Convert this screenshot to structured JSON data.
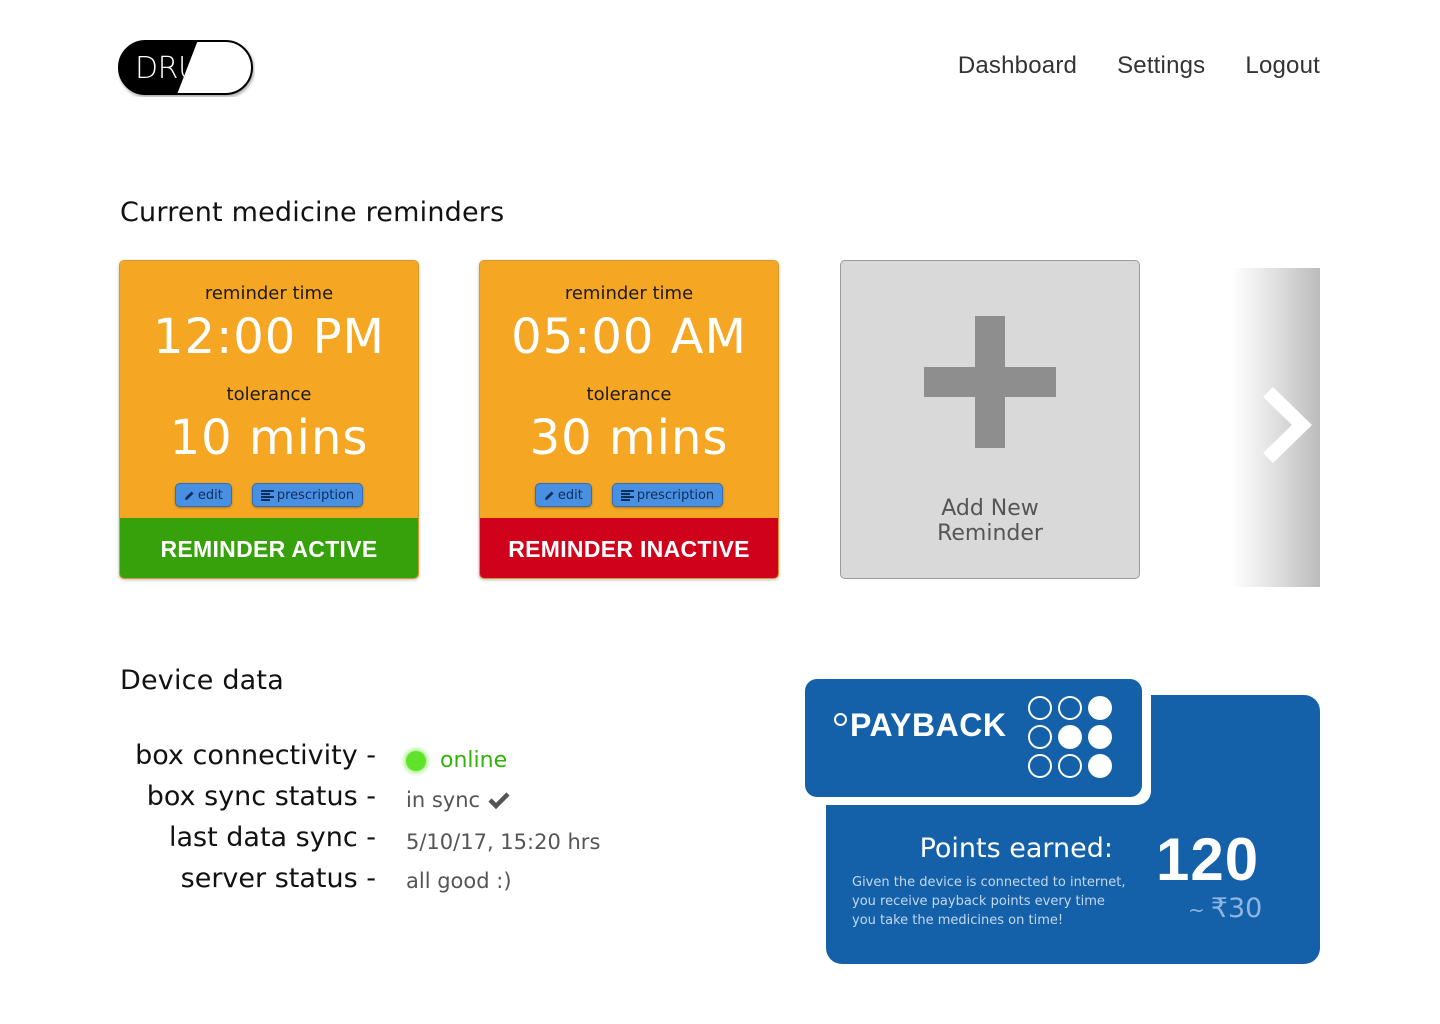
{
  "brand": {
    "logo_text": "DRUX"
  },
  "nav": {
    "items": [
      "Dashboard",
      "Settings",
      "Logout"
    ]
  },
  "reminders": {
    "title": "Current medicine reminders",
    "cards": [
      {
        "time_label": "reminder time",
        "time": "12:00 PM",
        "tolerance_label": "tolerance",
        "tolerance": "10 mins",
        "edit_label": "edit",
        "prescription_label": "prescription",
        "status": "REMINDER ACTIVE",
        "status_color": "#36a10a"
      },
      {
        "time_label": "reminder time",
        "time": "05:00 AM",
        "tolerance_label": "tolerance",
        "tolerance": "30 mins",
        "edit_label": "edit",
        "prescription_label": "prescription",
        "status": "REMINDER INACTIVE",
        "status_color": "#d0021b"
      }
    ],
    "add_label_line1": "Add New",
    "add_label_line2": "Reminder",
    "card_color": "#f5a623"
  },
  "device": {
    "title": "Device data",
    "rows": [
      {
        "key": "box connectivity -",
        "value": "online",
        "icon": "status-dot-icon"
      },
      {
        "key": "box sync status -",
        "value": "in sync",
        "icon": "checkmark-icon"
      },
      {
        "key": "last data sync -",
        "value": "5/10/17, 15:20 hrs"
      },
      {
        "key": "server status -",
        "value": "all good :)"
      }
    ]
  },
  "payback": {
    "brand": "PAYBACK",
    "points_label": "Points earned:",
    "description": "Given the device is connected to internet, you receive payback points every time you take the medicines on time!",
    "points": "120",
    "money_prefix": "~",
    "money": "₹30",
    "color": "#1461aa"
  }
}
